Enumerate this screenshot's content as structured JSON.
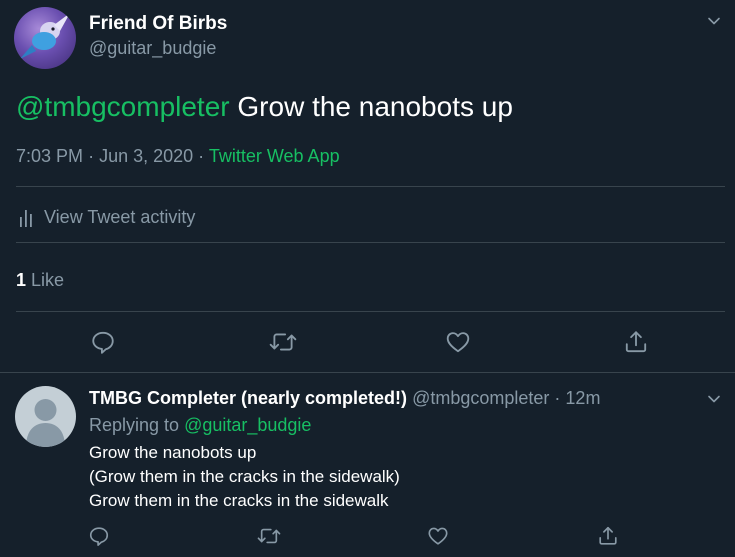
{
  "tweet": {
    "author_name": "Friend Of Birbs",
    "author_handle": "@guitar_budgie",
    "mention": "@tmbgcompleter",
    "text": "Grow the nanobots up",
    "time": "7:03 PM",
    "date": "Jun 3, 2020",
    "separator": "·",
    "source": "Twitter Web App",
    "activity_label": "View Tweet activity",
    "likes_count": "1",
    "likes_label": "Like"
  },
  "reply": {
    "author_name": "TMBG Completer (nearly completed!)",
    "author_handle": "@tmbgcompleter",
    "separator": "·",
    "time_ago": "12m",
    "replying_to_label": "Replying to",
    "replying_to_handle": "@guitar_budgie",
    "lines": [
      "Grow the nanobots up",
      "(Grow them in the cracks in the sidewalk)",
      "Grow them in the cracks in the sidewalk"
    ]
  },
  "icons": {
    "caret": "chevron-down-icon",
    "activity": "bar-chart-icon",
    "reply": "reply-icon",
    "retweet": "retweet-icon",
    "like": "heart-icon",
    "share": "share-icon"
  },
  "colors": {
    "background": "#15202b",
    "accent_green": "#17bf63",
    "muted_text": "#8899a6",
    "divider": "#38444d"
  }
}
